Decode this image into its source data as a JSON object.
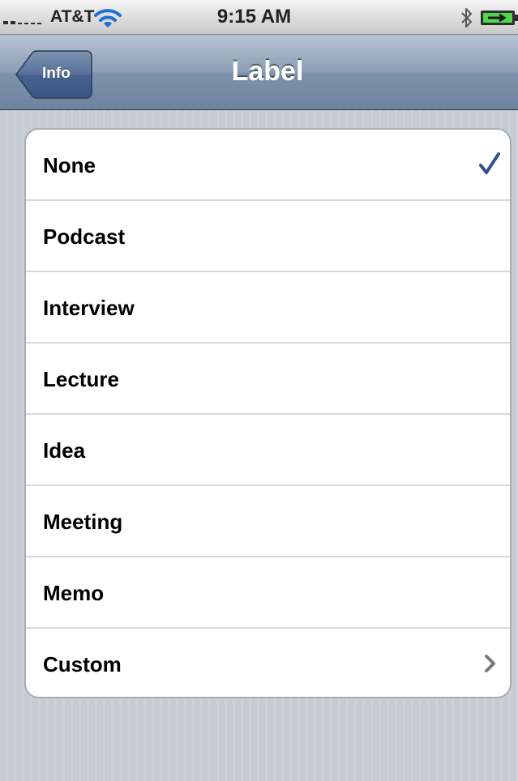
{
  "status_bar": {
    "carrier": "AT&T",
    "time": "9:15 AM",
    "signal_icon": "signal-strength-icon",
    "wifi_icon": "wifi-icon",
    "bluetooth_icon": "bluetooth-icon",
    "battery_icon": "battery-charging-icon"
  },
  "nav_bar": {
    "back_label": "Info",
    "title": "Label"
  },
  "options": [
    {
      "label": "None",
      "selected": true,
      "accessory": "checkmark-icon"
    },
    {
      "label": "Podcast",
      "selected": false
    },
    {
      "label": "Interview",
      "selected": false
    },
    {
      "label": "Lecture",
      "selected": false
    },
    {
      "label": "Idea",
      "selected": false
    },
    {
      "label": "Meeting",
      "selected": false
    },
    {
      "label": "Memo",
      "selected": false
    },
    {
      "label": "Custom",
      "selected": false,
      "accessory": "chevron-right-icon"
    }
  ],
  "colors": {
    "nav_tint": "#6d83a0",
    "checkmark": "#34538d",
    "background": "#c5ccd4"
  }
}
